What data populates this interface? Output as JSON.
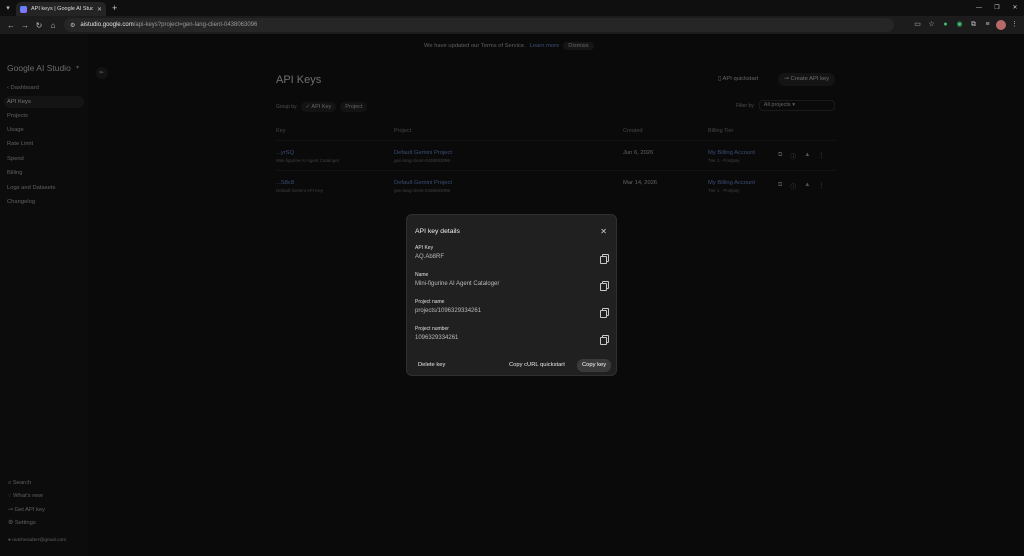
{
  "browser": {
    "tab_title": "API keys | Google AI Studio",
    "url_host": "aistudio.google.com",
    "url_path": "/api-keys?project=gen-lang-client-0438063096"
  },
  "page": {
    "banner": {
      "text": "We have updated our Terms of Service.",
      "link": "Learn more",
      "dismiss": "Dismiss"
    },
    "sidebar": {
      "brand": "Google AI Studio",
      "items": [
        "Dashboard",
        "API Keys",
        "Projects",
        "Usage",
        "Rate Limit",
        "Spend",
        "Billing",
        "Logs and Datasets",
        "Changelog"
      ],
      "bottom": [
        "Search",
        "What's new",
        "Get API key",
        "Settings",
        "nutcheraderr@gmail.com"
      ]
    },
    "title": "API Keys",
    "quickstart_label": "API quickstart",
    "create_label": "Create API key",
    "group_by_label": "Group by",
    "group_chips": [
      "API Key",
      "Project"
    ],
    "filter_label": "Filter by",
    "filter_value": "All projects",
    "columns": [
      "Key",
      "Project",
      "Created",
      "Billing Tier"
    ],
    "rows": [
      {
        "key": "...yrSQ",
        "key_sub": "Mini-figurine AI Agent Cataloger",
        "project": "Default Gemini Project",
        "project_sub": "gen-lang-client-0438063096",
        "created": "Jun 6, 2026",
        "billing": "My Billing Account",
        "billing_sub": "Tier 1 · Postpay"
      },
      {
        "key": "...S8c8",
        "key_sub": "Default Gemini API Key",
        "project": "Default Gemini Project",
        "project_sub": "gen-lang-client-0438063096",
        "created": "Mar 14, 2026",
        "billing": "My Billing Account",
        "billing_sub": "Tier 1 · Postpay"
      }
    ]
  },
  "dialog": {
    "title": "API key details",
    "fields": [
      {
        "label": "API Key",
        "value": "AQ.Ab8RF"
      },
      {
        "label": "Name",
        "value": "Mini-figurine AI Agent Cataloger"
      },
      {
        "label": "Project name",
        "value": "projects/1096329334261"
      },
      {
        "label": "Project number",
        "value": "1096329334261"
      }
    ],
    "delete_label": "Delete key",
    "curl_label": "Copy cURL quickstart",
    "copy_key_label": "Copy key"
  }
}
